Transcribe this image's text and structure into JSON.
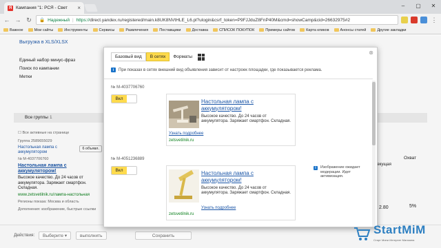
{
  "browser": {
    "tab_title": "Кампания \"1: РСЯ - Свет",
    "tab_favicon_letter": "Я",
    "secure_label": "Надежный",
    "url_prefix": "https://",
    "url_rest": "direct.yandex.ru/registered/main.k8UK8NVtHLE_L6.pl?ulogin&csrf_token=P9FJJduZ8FnP40M&cmd=showCamp&cid=26632975#2",
    "bookmarks": [
      {
        "label": "Важное"
      },
      {
        "label": "Мои сайты"
      },
      {
        "label": "Инструменты"
      },
      {
        "label": "Сервисы"
      },
      {
        "label": "Развлечения"
      },
      {
        "label": "Поставщики"
      },
      {
        "label": "Доставка"
      },
      {
        "label": "СПИСОК ПОКУПОК"
      },
      {
        "label": "Примеры сайтов"
      },
      {
        "label": "Карта кликов"
      },
      {
        "label": "Анонсы статей"
      },
      {
        "label": "Другие закладки"
      }
    ]
  },
  "background": {
    "export_link": "Выгрузка в XLS/XLSX",
    "minus_phrases": "Единый набор минус-фраз",
    "search_by_campaign": "Поиск по кампании",
    "tags": "Метки",
    "groups_label": "Все группы",
    "groups_count": "1",
    "show_all": "Все активные на странице",
    "group_id": "Группа 2589655029",
    "campaign_name": "Настольная лампа с аккумулятором",
    "ads_button": "6 объявл.",
    "ad_number": "№ M-4037706760",
    "ad_title": "Настольная лампа с аккумулятором!",
    "ad_text": "Высокое качество. До 24 часов от аккумулятора. Заряжает смартфон. Складная.",
    "ad_link": "www.zetsvetilnik.ru/лампа-настольная",
    "regions": "Регионы показа: Москва и область",
    "extras": "Дополнения: изображение, быстрые ссылки",
    "col_coverage": "Охват",
    "col_current": "Текущая",
    "val_price": "2.80",
    "val_coverage": "5%",
    "action_label": "Действия:",
    "select_label": "Выберите",
    "run_button": "выполнить",
    "save_button": "Сохранить"
  },
  "modal": {
    "tabs": [
      {
        "label": "Базовый вид"
      },
      {
        "label": "В сетях"
      },
      {
        "label": "Форматы"
      }
    ],
    "info_text": "При показах в сетях внешний вид объявления зависит от настроек площадки, где показывается реклама.",
    "ads": [
      {
        "number": "№ M-4037706760",
        "toggle_label": "Вкл",
        "title": "Настольная лампа с аккумулятором!",
        "text": "Высокое качество. До 24 часов от аккумулятора. Заряжает смартфон. Складная.",
        "more": "Узнать подробнее",
        "domain": "zetsvetilnik.ru"
      },
      {
        "number": "№ M-4051236889",
        "toggle_label": "Вкл",
        "title": "Настольная лампа с аккумулятором!",
        "text": "Высокое качество. До 24 часов от аккумулятора. Заряжает смартфон. Складная.",
        "more": "Узнать подробнее",
        "domain": "zetsvetilnik.ru",
        "moderation_note": "Изображение ожидает модерации. Идет активизация."
      }
    ]
  },
  "logo": {
    "brand": "StartMiM",
    "tagline": "Старт Мини Интернет Магазина"
  }
}
